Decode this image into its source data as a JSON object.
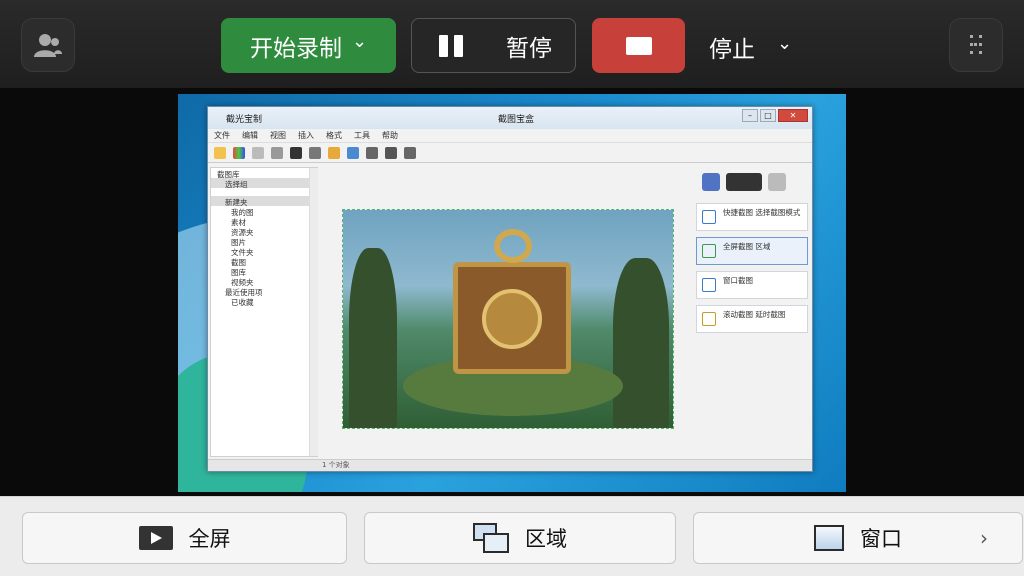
{
  "toolbar": {
    "record_label": "开始录制",
    "record_chevron": "⌄",
    "pause_label": "暂停",
    "stop_label": "停止",
    "stop_chevron": "⌄",
    "colors": {
      "record": "#2f8c3f",
      "stop": "#c8403a",
      "bar": "#1f1f1f"
    },
    "left_icon": "participants-icon",
    "right_icon": "more-vertical-icon"
  },
  "preview": {
    "app_window": {
      "title_app": "截光宝制",
      "title_doc": "截图宝盒",
      "menu": [
        "文件",
        "编辑",
        "视图",
        "插入",
        "格式",
        "工具",
        "帮助"
      ],
      "tree": [
        "截图库",
        "选择组",
        "新建夹",
        "我的图",
        "素材",
        "资源夹",
        "图片",
        "文件夹",
        "截图",
        "图库",
        "视频夹",
        "最近使用项",
        "已收藏"
      ],
      "side_cards": [
        "快捷截图 选择截图模式",
        "全屏截图 区域",
        "窗口截图",
        "滚动截图 延时截图"
      ],
      "status": "1 个对象"
    }
  },
  "modes": {
    "fullscreen_label": "全屏",
    "region_label": "区域",
    "window_label": "窗口",
    "more_chevron": "›"
  }
}
